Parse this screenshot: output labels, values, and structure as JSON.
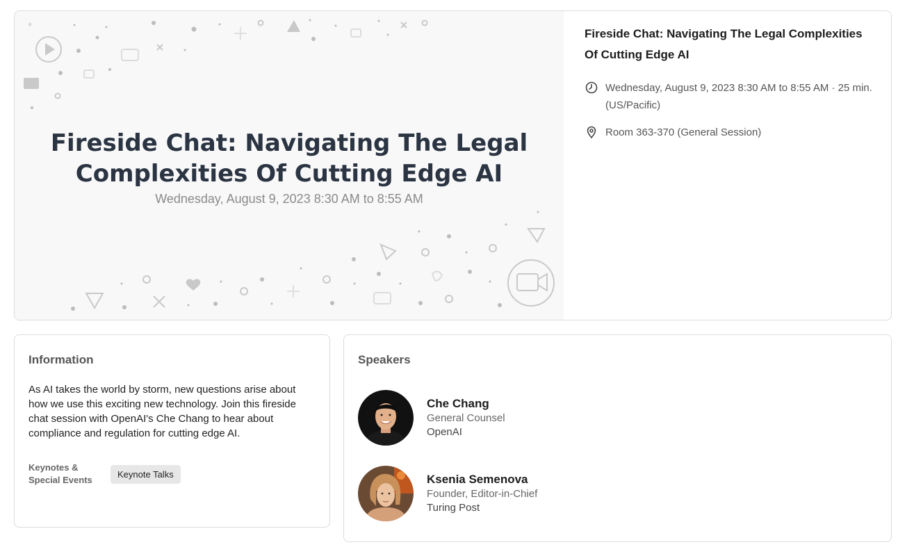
{
  "banner": {
    "title": "Fireside Chat: Navigating The Legal Complexities Of Cutting Edge AI",
    "date": "Wednesday, August 9, 2023 8:30 AM to 8:55 AM"
  },
  "session": {
    "title": "Fireside Chat: Navigating The Legal Complexities Of Cutting Edge AI",
    "time": "Wednesday, August 9, 2023 8:30 AM to 8:55 AM · 25 min. (US/Pacific)",
    "location": "Room 363-370 (General Session)",
    "time_icon": "clock-icon",
    "location_icon": "location-pin-icon"
  },
  "information": {
    "heading": "Information",
    "description": "As AI takes the world by storm, new questions arise about how we use this exciting new technology. Join this fireside chat session with OpenAI's Che Chang to hear about compliance and regulation for cutting edge AI.",
    "category": "Keynotes & Special Events",
    "tag": "Keynote Talks"
  },
  "speakers": {
    "heading": "Speakers",
    "list": [
      {
        "name": "Che Chang",
        "role": "General Counsel",
        "org": "OpenAI"
      },
      {
        "name": "Ksenia Semenova",
        "role": "Founder, Editor-in-Chief",
        "org": "Turing Post"
      }
    ]
  }
}
